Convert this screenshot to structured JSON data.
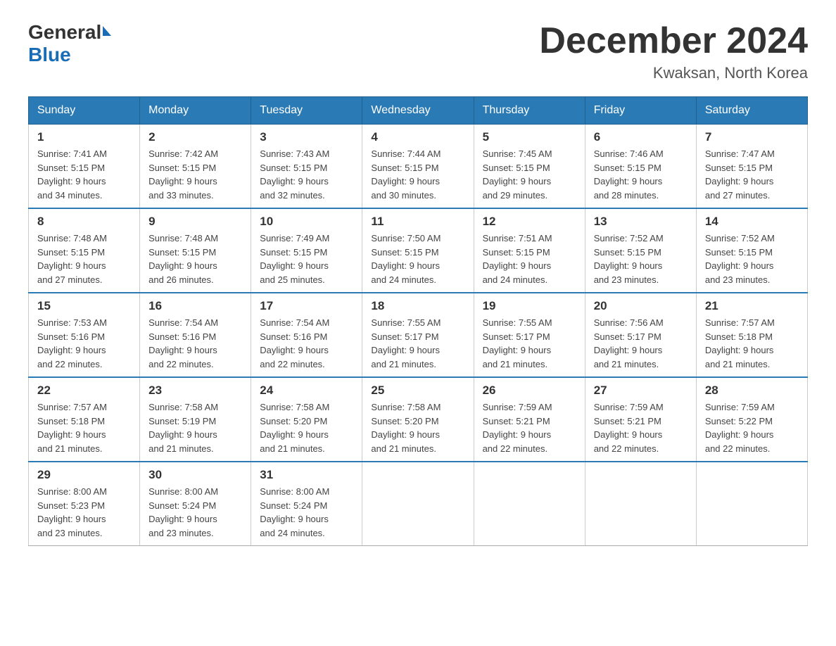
{
  "header": {
    "logo_general": "General",
    "logo_blue": "Blue",
    "month_title": "December 2024",
    "location": "Kwaksan, North Korea"
  },
  "days_of_week": [
    "Sunday",
    "Monday",
    "Tuesday",
    "Wednesday",
    "Thursday",
    "Friday",
    "Saturday"
  ],
  "weeks": [
    [
      {
        "day": "1",
        "sunrise": "7:41 AM",
        "sunset": "5:15 PM",
        "daylight": "9 hours and 34 minutes."
      },
      {
        "day": "2",
        "sunrise": "7:42 AM",
        "sunset": "5:15 PM",
        "daylight": "9 hours and 33 minutes."
      },
      {
        "day": "3",
        "sunrise": "7:43 AM",
        "sunset": "5:15 PM",
        "daylight": "9 hours and 32 minutes."
      },
      {
        "day": "4",
        "sunrise": "7:44 AM",
        "sunset": "5:15 PM",
        "daylight": "9 hours and 30 minutes."
      },
      {
        "day": "5",
        "sunrise": "7:45 AM",
        "sunset": "5:15 PM",
        "daylight": "9 hours and 29 minutes."
      },
      {
        "day": "6",
        "sunrise": "7:46 AM",
        "sunset": "5:15 PM",
        "daylight": "9 hours and 28 minutes."
      },
      {
        "day": "7",
        "sunrise": "7:47 AM",
        "sunset": "5:15 PM",
        "daylight": "9 hours and 27 minutes."
      }
    ],
    [
      {
        "day": "8",
        "sunrise": "7:48 AM",
        "sunset": "5:15 PM",
        "daylight": "9 hours and 27 minutes."
      },
      {
        "day": "9",
        "sunrise": "7:48 AM",
        "sunset": "5:15 PM",
        "daylight": "9 hours and 26 minutes."
      },
      {
        "day": "10",
        "sunrise": "7:49 AM",
        "sunset": "5:15 PM",
        "daylight": "9 hours and 25 minutes."
      },
      {
        "day": "11",
        "sunrise": "7:50 AM",
        "sunset": "5:15 PM",
        "daylight": "9 hours and 24 minutes."
      },
      {
        "day": "12",
        "sunrise": "7:51 AM",
        "sunset": "5:15 PM",
        "daylight": "9 hours and 24 minutes."
      },
      {
        "day": "13",
        "sunrise": "7:52 AM",
        "sunset": "5:15 PM",
        "daylight": "9 hours and 23 minutes."
      },
      {
        "day": "14",
        "sunrise": "7:52 AM",
        "sunset": "5:15 PM",
        "daylight": "9 hours and 23 minutes."
      }
    ],
    [
      {
        "day": "15",
        "sunrise": "7:53 AM",
        "sunset": "5:16 PM",
        "daylight": "9 hours and 22 minutes."
      },
      {
        "day": "16",
        "sunrise": "7:54 AM",
        "sunset": "5:16 PM",
        "daylight": "9 hours and 22 minutes."
      },
      {
        "day": "17",
        "sunrise": "7:54 AM",
        "sunset": "5:16 PM",
        "daylight": "9 hours and 22 minutes."
      },
      {
        "day": "18",
        "sunrise": "7:55 AM",
        "sunset": "5:17 PM",
        "daylight": "9 hours and 21 minutes."
      },
      {
        "day": "19",
        "sunrise": "7:55 AM",
        "sunset": "5:17 PM",
        "daylight": "9 hours and 21 minutes."
      },
      {
        "day": "20",
        "sunrise": "7:56 AM",
        "sunset": "5:17 PM",
        "daylight": "9 hours and 21 minutes."
      },
      {
        "day": "21",
        "sunrise": "7:57 AM",
        "sunset": "5:18 PM",
        "daylight": "9 hours and 21 minutes."
      }
    ],
    [
      {
        "day": "22",
        "sunrise": "7:57 AM",
        "sunset": "5:18 PM",
        "daylight": "9 hours and 21 minutes."
      },
      {
        "day": "23",
        "sunrise": "7:58 AM",
        "sunset": "5:19 PM",
        "daylight": "9 hours and 21 minutes."
      },
      {
        "day": "24",
        "sunrise": "7:58 AM",
        "sunset": "5:20 PM",
        "daylight": "9 hours and 21 minutes."
      },
      {
        "day": "25",
        "sunrise": "7:58 AM",
        "sunset": "5:20 PM",
        "daylight": "9 hours and 21 minutes."
      },
      {
        "day": "26",
        "sunrise": "7:59 AM",
        "sunset": "5:21 PM",
        "daylight": "9 hours and 22 minutes."
      },
      {
        "day": "27",
        "sunrise": "7:59 AM",
        "sunset": "5:21 PM",
        "daylight": "9 hours and 22 minutes."
      },
      {
        "day": "28",
        "sunrise": "7:59 AM",
        "sunset": "5:22 PM",
        "daylight": "9 hours and 22 minutes."
      }
    ],
    [
      {
        "day": "29",
        "sunrise": "8:00 AM",
        "sunset": "5:23 PM",
        "daylight": "9 hours and 23 minutes."
      },
      {
        "day": "30",
        "sunrise": "8:00 AM",
        "sunset": "5:24 PM",
        "daylight": "9 hours and 23 minutes."
      },
      {
        "day": "31",
        "sunrise": "8:00 AM",
        "sunset": "5:24 PM",
        "daylight": "9 hours and 24 minutes."
      },
      null,
      null,
      null,
      null
    ]
  ],
  "labels": {
    "sunrise": "Sunrise:",
    "sunset": "Sunset:",
    "daylight": "Daylight:"
  }
}
